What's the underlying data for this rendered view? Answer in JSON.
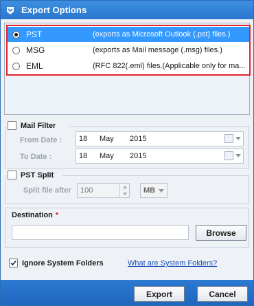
{
  "window": {
    "title": "Export Options",
    "app_icon": "app-logo-icon"
  },
  "formats": [
    {
      "name": "PST",
      "description": "(exports as Microsoft Outlook (.pst) files.)",
      "selected": true
    },
    {
      "name": "MSG",
      "description": "(exports as Mail message (.msg) files.)",
      "selected": false
    },
    {
      "name": "EML",
      "description": "(RFC 822(.eml) files.(Applicable only for ma...",
      "selected": false
    }
  ],
  "mail_filter": {
    "label": "Mail Filter",
    "checked": false,
    "from_label": "From Date :",
    "to_label": "To Date :",
    "from": {
      "day": "18",
      "month": "May",
      "year": "2015"
    },
    "to": {
      "day": "18",
      "month": "May",
      "year": "2015"
    }
  },
  "pst_split": {
    "label": "PST Split",
    "checked": false,
    "size_label": "Split file after",
    "size_value": "100",
    "unit": "MB"
  },
  "destination": {
    "label": "Destination",
    "required_mark": "*",
    "value": "",
    "browse_label": "Browse"
  },
  "ignore_system_folders": {
    "label": "Ignore System Folders",
    "checked": true
  },
  "help_link": "What are System Folders?",
  "footer": {
    "export_label": "Export",
    "cancel_label": "Cancel"
  },
  "colors": {
    "title_bar": "#2a77cf",
    "selection": "#3399ff",
    "highlight_border": "#e0262f",
    "link": "#1a4fb8"
  }
}
